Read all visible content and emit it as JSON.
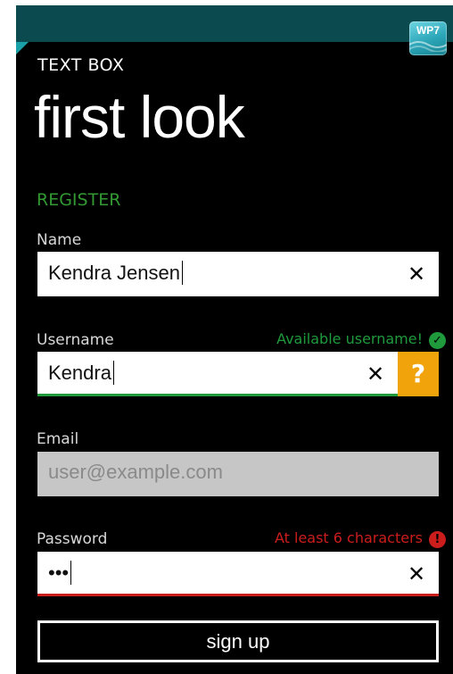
{
  "badge": {
    "text": "WP7"
  },
  "header": {
    "app_title": "TEXT BOX",
    "page_title": "first look"
  },
  "form": {
    "section_label": "REGISTER",
    "name": {
      "label": "Name",
      "value": "Kendra Jensen"
    },
    "username": {
      "label": "Username",
      "value": "Kendra",
      "status": "Available username!",
      "help_label": "?"
    },
    "email": {
      "label": "Email",
      "placeholder": "user@example.com"
    },
    "password": {
      "label": "Password",
      "value": "•••",
      "status": "At least 6 characters"
    },
    "clear_glyph": "✕",
    "ok_glyph": "✓",
    "error_glyph": "!",
    "submit_label": "sign up"
  },
  "colors": {
    "accent": "#339933",
    "success": "#1f9a3c",
    "error": "#cc1d1d",
    "help": "#f0a30a",
    "topbar": "#0b4a4e"
  }
}
